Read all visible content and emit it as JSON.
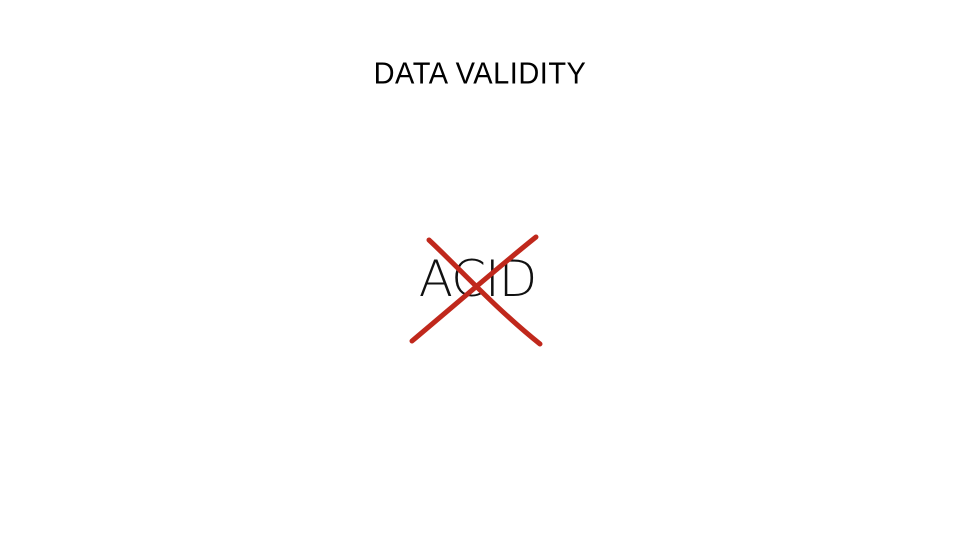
{
  "slide": {
    "title": "DATA VALIDITY",
    "crossed_word": "ACID"
  },
  "colors": {
    "background": "#ffffff",
    "text": "#000000",
    "strike": "#c0281c"
  },
  "icons": {
    "strike_mark": "red-x-cross-out-icon"
  }
}
